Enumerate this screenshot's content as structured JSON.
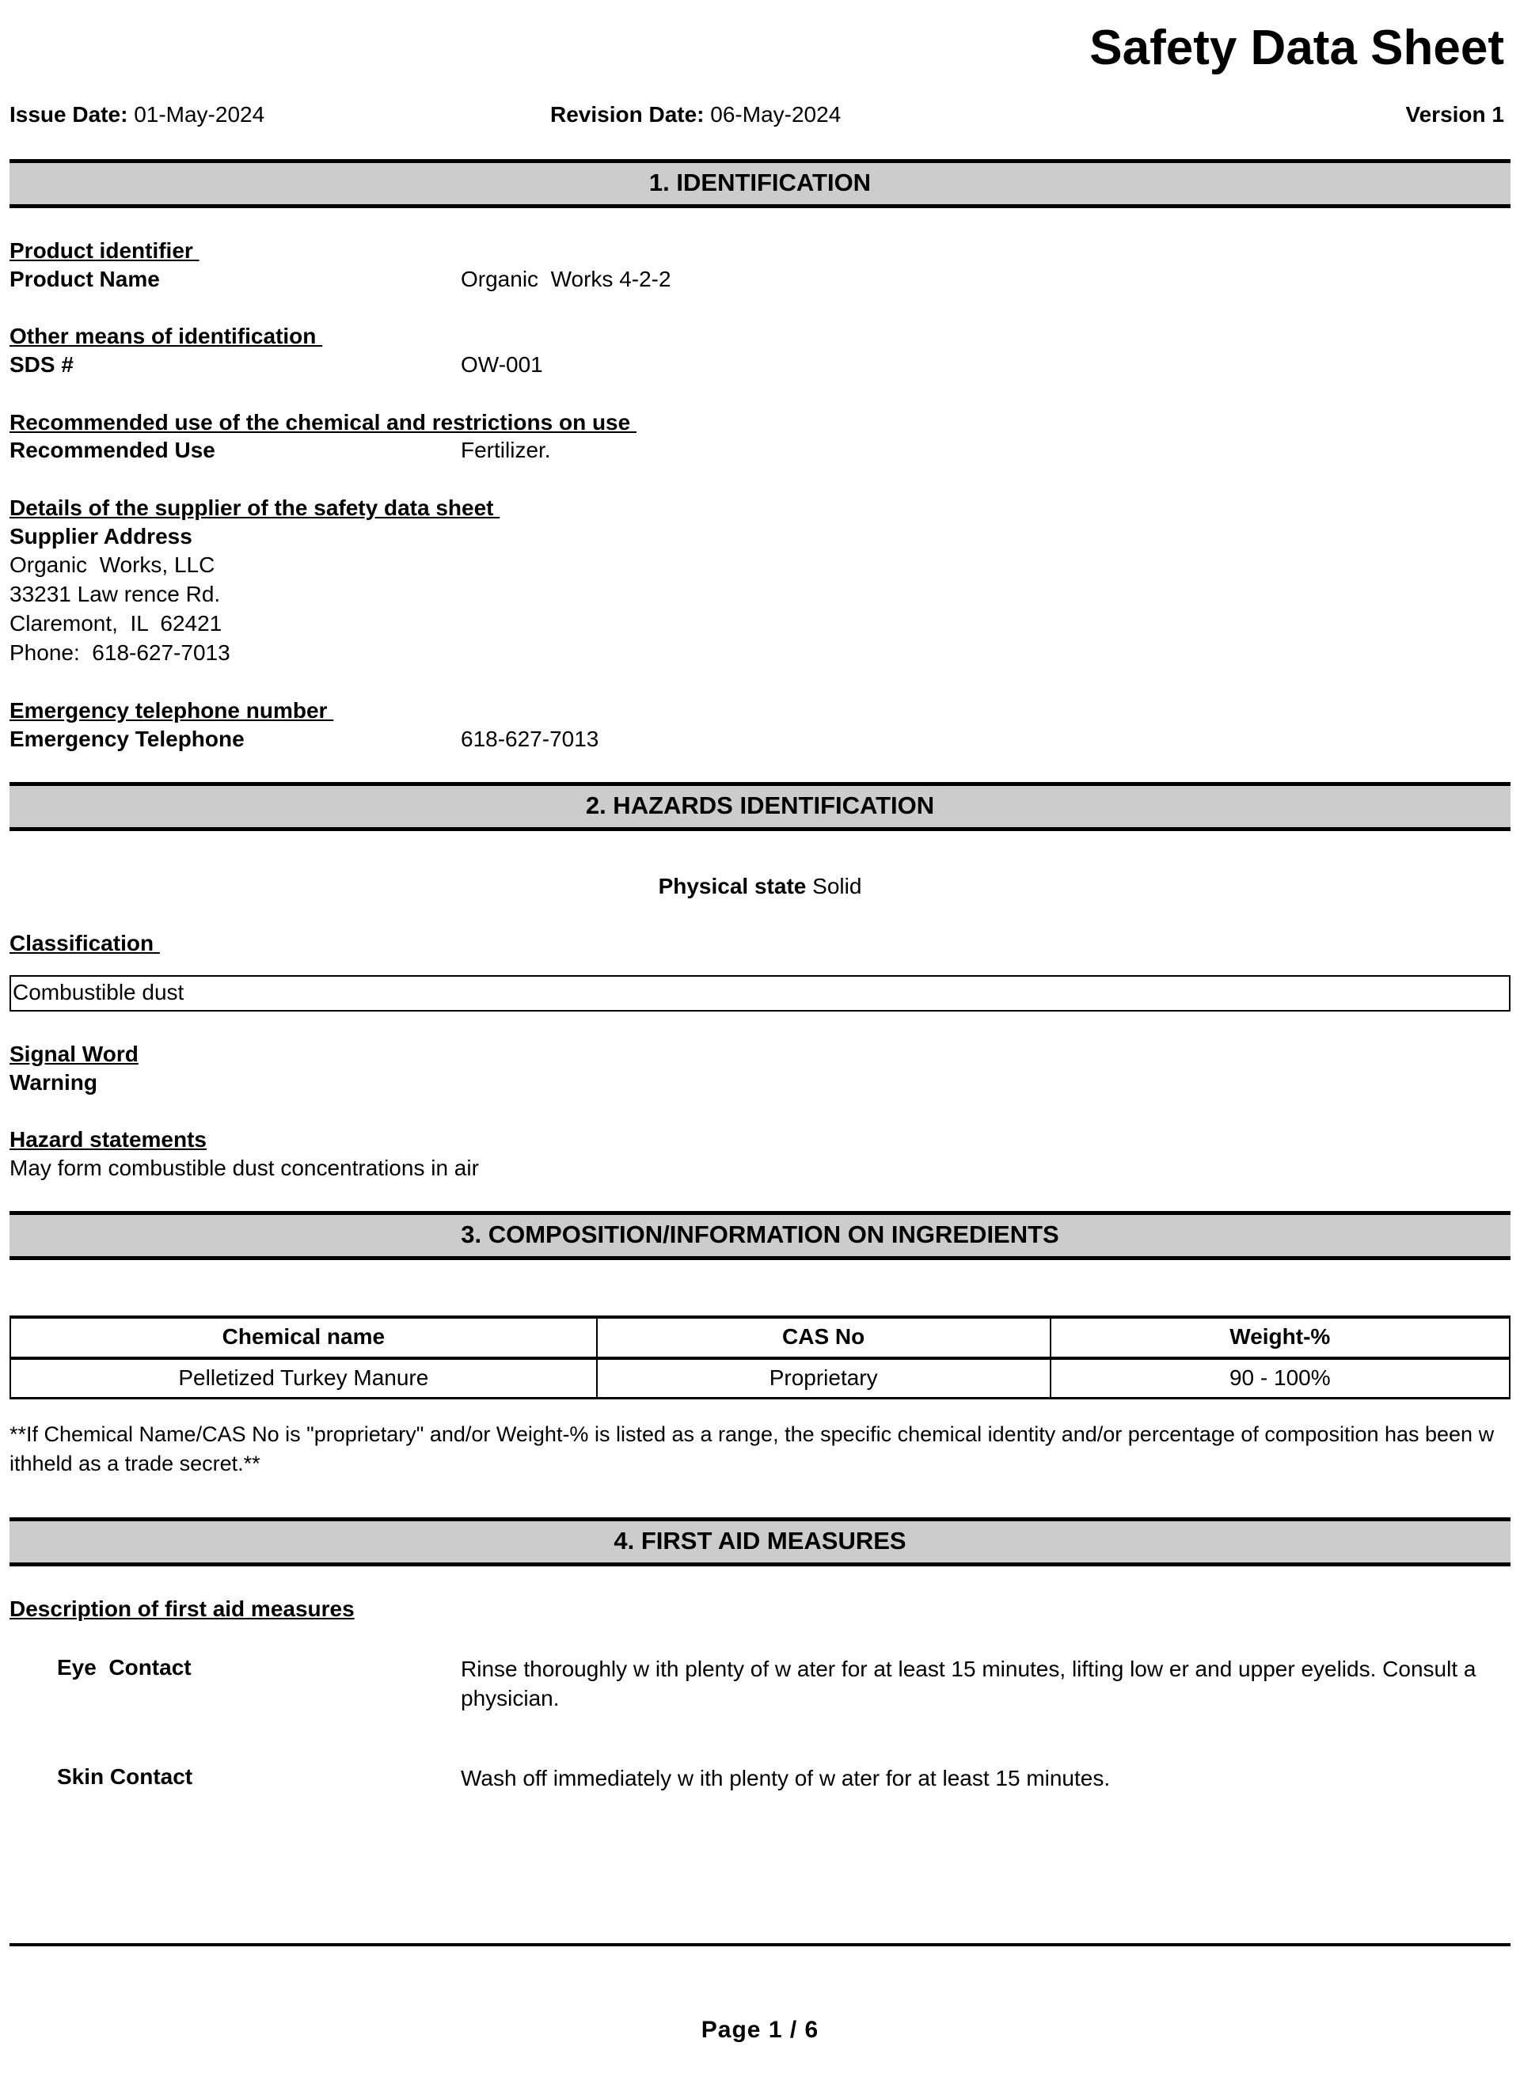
{
  "document": {
    "title": "Safety Data Sheet",
    "page_footer": "Page  1 / 6"
  },
  "header": {
    "issue_date_label": "Issue Date:",
    "issue_date_value": "01-May-2024",
    "revision_date_label": "Revision Date:",
    "revision_date_value": "06-May-2024",
    "version_label": "Version",
    "version_value": "1"
  },
  "sections": {
    "identification": {
      "bar_title": "1. IDENTIFICATION",
      "product_identifier_heading": "Product identifier ",
      "product_name_label": "Product Name",
      "product_name_value": "Organic  Works 4-2-2",
      "other_means_heading": "Other means of identification ",
      "sds_number_label": "SDS #",
      "sds_number_value": "OW-001",
      "recommended_use_heading": "Recommended use of the chemical and restrictions on use ",
      "recommended_use_label": "Recommended Use",
      "recommended_use_value": "Fertilizer.",
      "supplier_details_heading": "Details of the supplier of the safety data sheet ",
      "supplier_address_label": "Supplier Address",
      "supplier_address_line1": "Organic  Works, LLC",
      "supplier_address_line2": "33231 Law rence Rd.",
      "supplier_address_line3": "Claremont,  IL  62421",
      "supplier_address_line4": "Phone:  618-627-7013",
      "emergency_heading": "Emergency telephone number ",
      "emergency_label": "Emergency Telephone",
      "emergency_value": "618-627-7013"
    },
    "hazards": {
      "bar_title": "2. HAZARDS IDENTIFICATION",
      "physical_state_label": "Physical state",
      "physical_state_value": "Solid",
      "classification_heading": "Classification ",
      "classification_value": "Combustible  dust",
      "signal_word_heading": "Signal Word",
      "signal_word_value": "Warning",
      "hazard_statements_heading": "Hazard statements",
      "hazard_statements_value": "May form combustible  dust concentrations in air"
    },
    "composition": {
      "bar_title": "3. COMPOSITION/INFORMATION ON INGREDIENTS",
      "table": {
        "columns": [
          "Chemical name",
          "CAS No",
          "Weight-%"
        ],
        "rows": [
          [
            "Pelletized  Turkey Manure",
            "Proprietary",
            "90 - 100%"
          ]
        ]
      },
      "footnote": "**If Chemical  Name/CAS  No is \"proprietary\" and/or Weight-%  is listed as a range, the specific chemical identity  and/or percentage of composition  has been w ithheld as a trade secret.**"
    },
    "first_aid": {
      "bar_title": "4. FIRST AID MEASURES",
      "description_heading": "Description of first aid measures",
      "measures": [
        {
          "label": "Eye  Contact",
          "text": "Rinse  thoroughly  w ith plenty  of w ater for at least 15 minutes,  lifting low er and upper eyelids. Consult  a physician."
        },
        {
          "label": "Skin Contact",
          "text": "Wash off immediately   w ith plenty  of w ater for at least 15 minutes."
        }
      ]
    }
  }
}
